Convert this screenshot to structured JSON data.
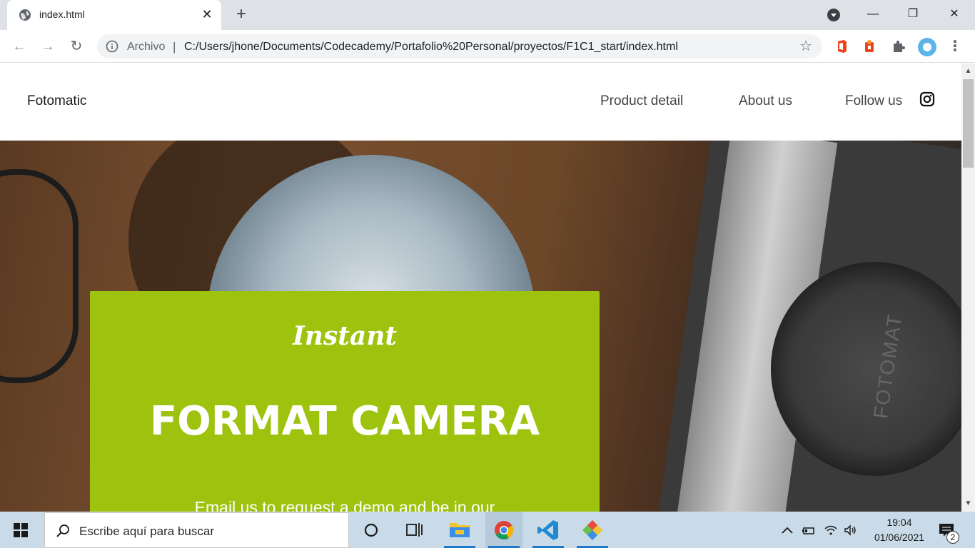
{
  "browser": {
    "tab": {
      "title": "index.html",
      "close_glyph": "✕"
    },
    "new_tab_glyph": "+",
    "window_controls": {
      "minimize": "—",
      "maximize": "❐",
      "close": "✕"
    },
    "toolbar": {
      "back_glyph": "←",
      "forward_glyph": "→",
      "reload_glyph": "↻",
      "security_label": "Archivo",
      "separator": "|",
      "url": "C:/Users/jhone/Documents/Codecademy/Portafolio%20Personal/proyectos/F1C1_start/index.html",
      "bookmark_glyph": "☆",
      "menu_glyph": "⋮"
    },
    "extensions": [
      "office-icon",
      "red-extension-icon",
      "puzzle-icon",
      "profile-avatar"
    ]
  },
  "page": {
    "nav": {
      "logo": "Fotomatic",
      "links": [
        "Product detail",
        "About us",
        "Follow us"
      ]
    },
    "promo": {
      "script_word": "Instant",
      "title": "FORMAT CAMERA",
      "text": "Email us to request a demo and be in our"
    },
    "hero": {
      "lens_text": "FOTOMAT"
    },
    "colors": {
      "promo_green": "#9ec30e",
      "nav_text": "#444444"
    }
  },
  "scrollbar": {
    "up_glyph": "▲",
    "down_glyph": "▼"
  },
  "taskbar": {
    "search_placeholder": "Escribe aquí para buscar",
    "time": "19:04",
    "date": "01/06/2021",
    "notification_count": "2",
    "pinned": [
      "cortana-icon",
      "task-view-icon",
      "file-explorer-icon",
      "chrome-icon",
      "vscode-icon",
      "git-icon"
    ]
  }
}
